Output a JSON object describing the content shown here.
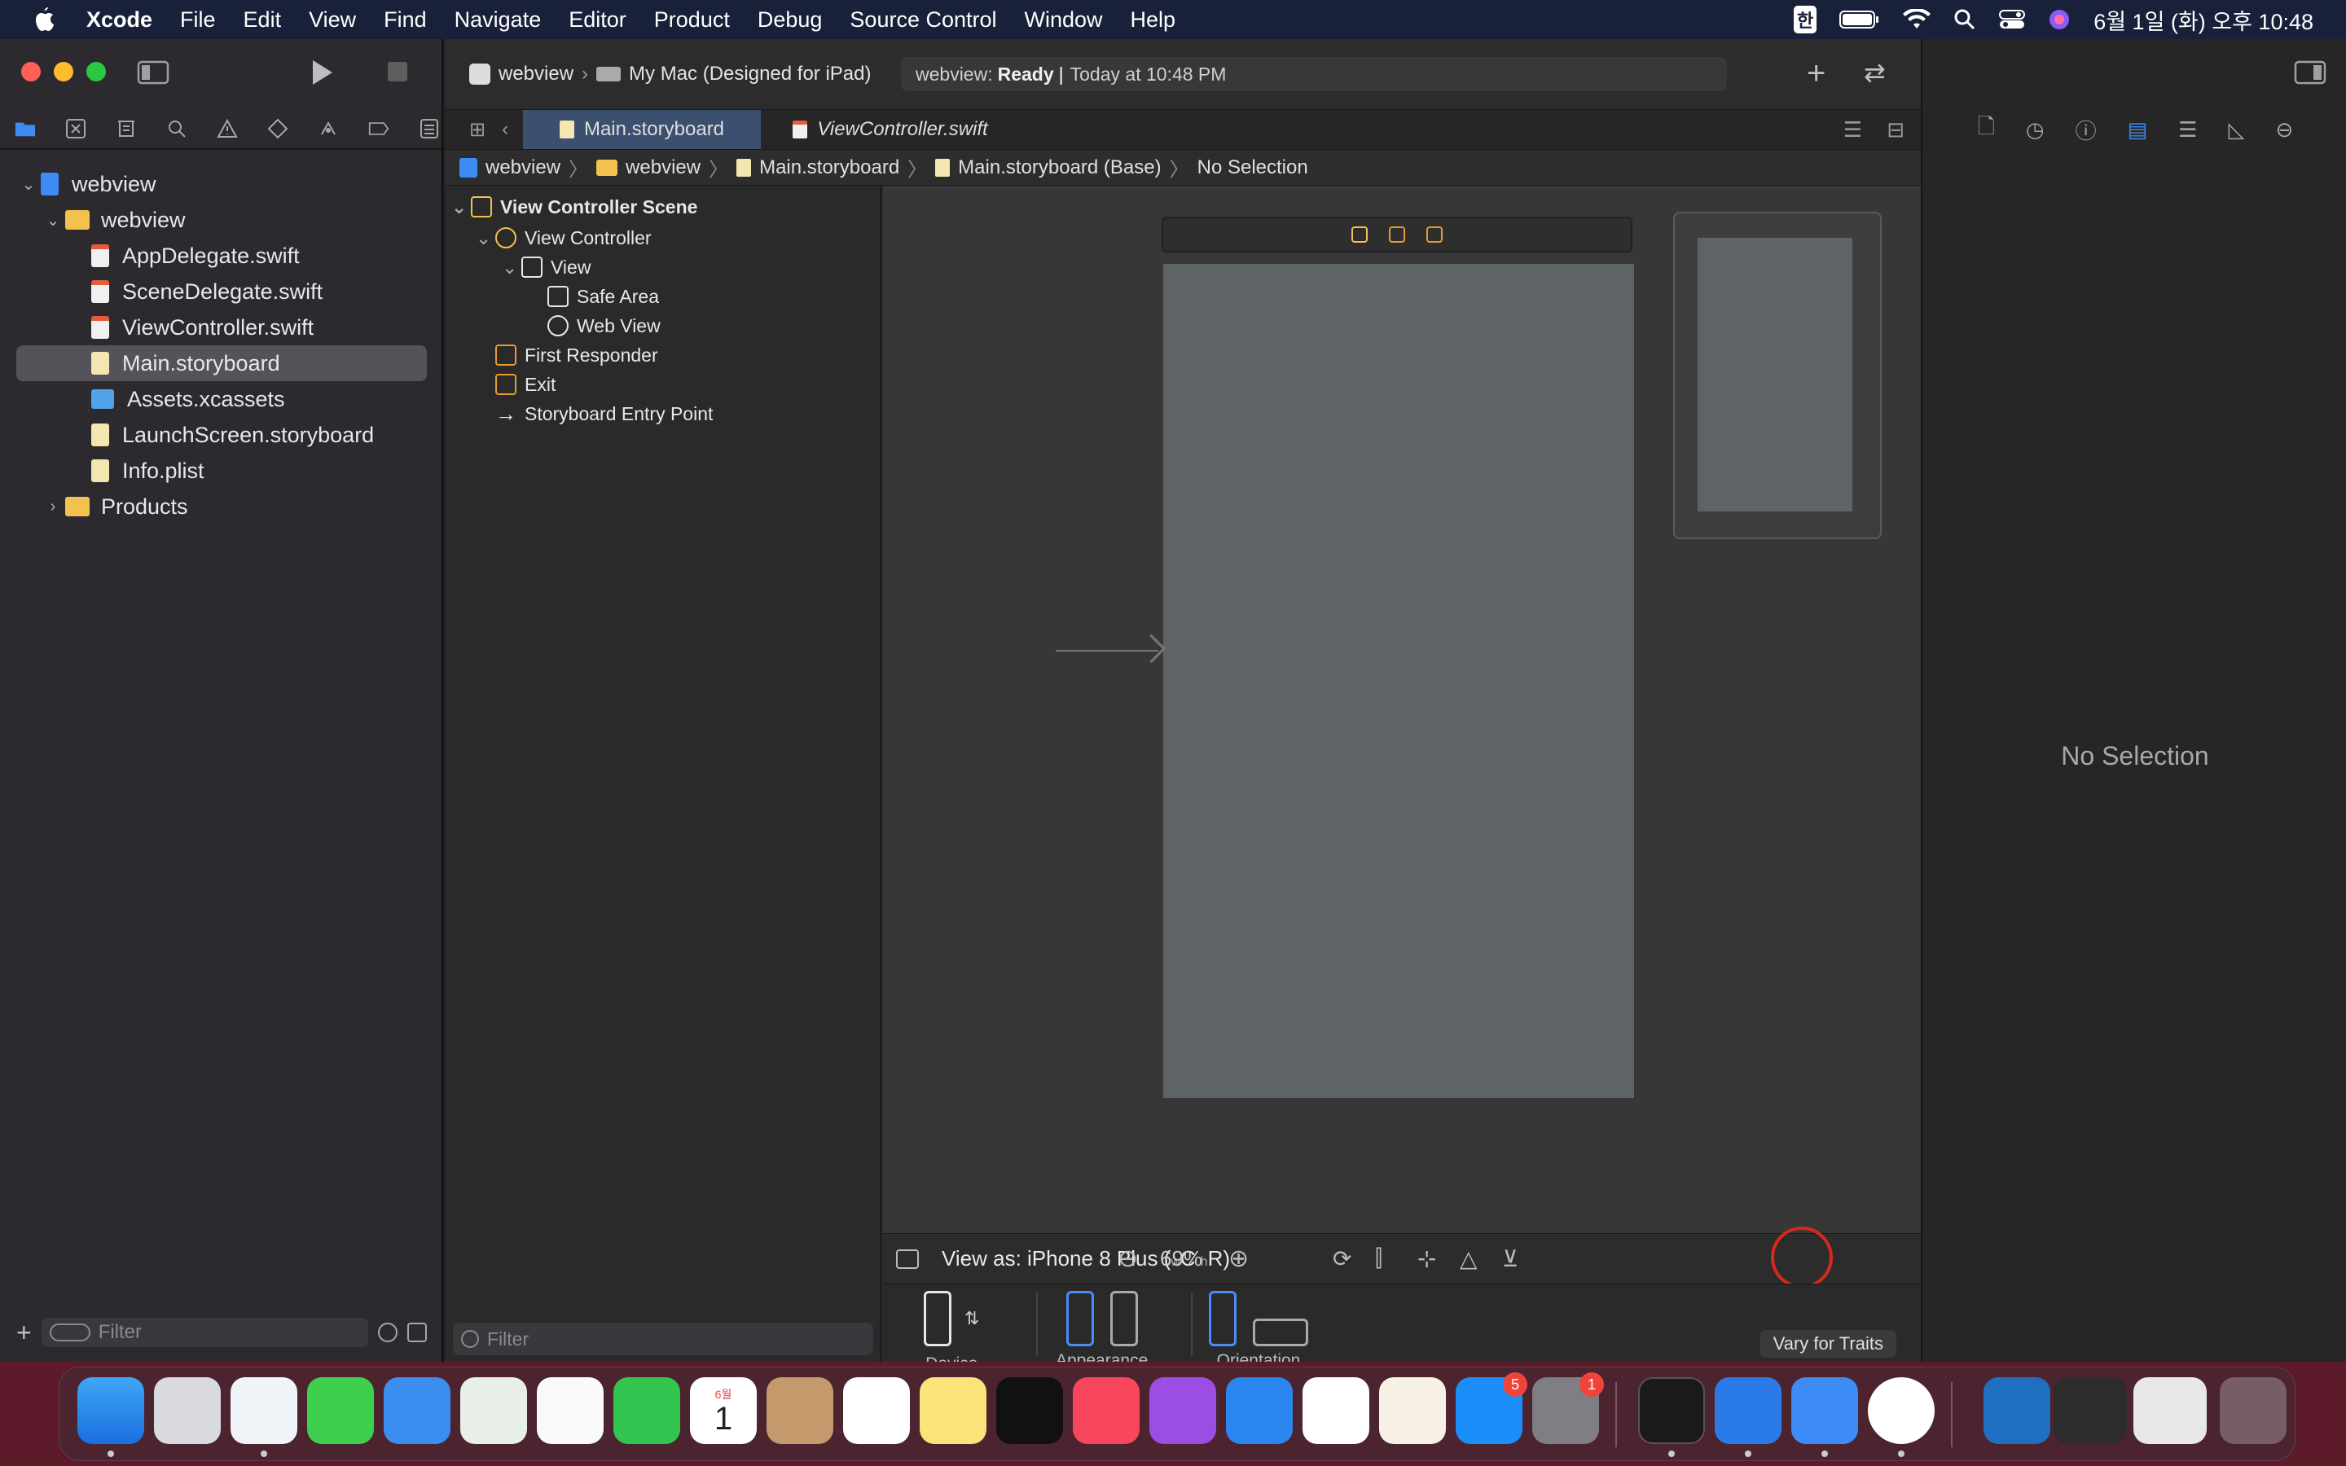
{
  "menubar": {
    "app_name": "Xcode",
    "items": [
      "File",
      "Edit",
      "View",
      "Find",
      "Navigate",
      "Editor",
      "Product",
      "Debug",
      "Source Control",
      "Window",
      "Help"
    ],
    "input_source": "한",
    "clock": "6월 1일 (화) 오후 10:48"
  },
  "navigator": {
    "tree": [
      {
        "label": "webview",
        "kind": "project"
      },
      {
        "label": "webview",
        "kind": "folder"
      },
      {
        "label": "AppDelegate.swift",
        "kind": "swift"
      },
      {
        "label": "SceneDelegate.swift",
        "kind": "swift"
      },
      {
        "label": "ViewController.swift",
        "kind": "swift"
      },
      {
        "label": "Main.storyboard",
        "kind": "storyboard"
      },
      {
        "label": "Assets.xcassets",
        "kind": "assets"
      },
      {
        "label": "LaunchScreen.storyboard",
        "kind": "storyboard"
      },
      {
        "label": "Info.plist",
        "kind": "plist"
      },
      {
        "label": "Products",
        "kind": "folder"
      }
    ],
    "filter_placeholder": "Filter"
  },
  "toolbar": {
    "scheme": "webview",
    "destination": "My Mac (Designed for iPad)",
    "status_project": "webview:",
    "status_state": "Ready",
    "status_time": "Today at 10:48 PM"
  },
  "tabs": [
    {
      "label": "Main.storyboard",
      "active": true
    },
    {
      "label": "ViewController.swift",
      "active": false
    }
  ],
  "jumpbar": [
    "webview",
    "webview",
    "Main.storyboard",
    "Main.storyboard (Base)",
    "No Selection"
  ],
  "outline": {
    "scene": "View Controller Scene",
    "items": [
      "View Controller",
      "View",
      "Safe Area",
      "Web View",
      "First Responder",
      "Exit",
      "Storyboard Entry Point"
    ],
    "filter_placeholder": "Filter"
  },
  "canvas_bottom": {
    "view_as_prefix": "View as: iPhone 8 Plus (",
    "size_class_w": "w",
    "size_class_w_val": "C",
    "size_class_h": "h",
    "size_class_h_val": "R",
    "view_as_suffix": ")",
    "zoom": "69%",
    "device_label": "Device",
    "appearance_label": "Appearance",
    "orientation_label": "Orientation",
    "vary_button": "Vary for Traits"
  },
  "inspector": {
    "empty_text": "No Selection"
  },
  "dock": {
    "calendar_month": "6월",
    "calendar_day": "1",
    "appstore_badge": "5",
    "settings_badge": "1"
  },
  "colors": {
    "accent": "#3c4f6e",
    "annotation": "#d8281c",
    "folder": "#f2c14e",
    "swift": "#e55b3c"
  }
}
